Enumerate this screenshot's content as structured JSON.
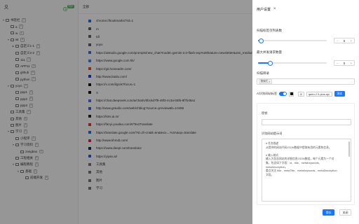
{
  "toolbar": {
    "sync_badge": "同步"
  },
  "tree": [
    {
      "label": "书签栏",
      "count": "2",
      "depth": 0,
      "caret": "▼"
    },
    {
      "label": "a",
      "count": "0",
      "depth": 1,
      "caret": ""
    },
    {
      "label": "w",
      "count": "1",
      "depth": 1,
      "caret": ""
    },
    {
      "label": "wt",
      "count": "4",
      "depth": 1,
      "caret": "▼"
    },
    {
      "label": "自定义1-1",
      "count": "1",
      "depth": 2,
      "caret": "▶"
    },
    {
      "label": "自定义2-2",
      "count": "0",
      "depth": 2,
      "caret": ""
    },
    {
      "label": "111",
      "count": "1",
      "depth": 2,
      "caret": ""
    },
    {
      "label": "APP11",
      "count": "1",
      "depth": 2,
      "caret": ""
    },
    {
      "label": "github",
      "count": "3",
      "depth": 2,
      "caret": ""
    },
    {
      "label": "python",
      "count": "1",
      "depth": 2,
      "caret": ""
    },
    {
      "label": "yoyo",
      "count": "3",
      "depth": 1,
      "caret": "▼"
    },
    {
      "label": "ppp1",
      "count": "1",
      "depth": 2,
      "caret": ""
    },
    {
      "label": "ppp2",
      "count": "0",
      "depth": 2,
      "caret": ""
    },
    {
      "label": "ppp3",
      "count": "1",
      "depth": 2,
      "caret": ""
    },
    {
      "label": "工具集",
      "count": "2",
      "depth": 1,
      "caret": ""
    },
    {
      "label": "其他",
      "count": "3",
      "depth": 1,
      "caret": ""
    },
    {
      "label": "图片",
      "count": "1",
      "depth": 1,
      "caret": ""
    },
    {
      "label": "学习",
      "count": "3",
      "depth": 1,
      "caret": "▼"
    },
    {
      "label": "小程序",
      "count": "1",
      "depth": 2,
      "caret": ""
    },
    {
      "label": "学习资料",
      "count": "2",
      "depth": 2,
      "caret": "▼"
    },
    {
      "label": "zangbao",
      "count": "0",
      "depth": 3,
      "caret": ""
    },
    {
      "label": "工程相关",
      "count": "0",
      "depth": 2,
      "caret": ""
    },
    {
      "label": "编程教程",
      "count": "1",
      "depth": 2,
      "caret": "▼"
    },
    {
      "label": "基础",
      "count": "2",
      "depth": 3,
      "caret": "▼"
    },
    {
      "label": "前端开发",
      "count": "3",
      "depth": 4,
      "caret": ""
    }
  ],
  "list_header": "全部",
  "list": [
    {
      "text": "chrome://bookmarks/?id=1",
      "color": "#1a73e8"
    },
    {
      "text": "m",
      "color": "#5f6368"
    },
    {
      "text": "tdl",
      "color": "#5f6368"
    },
    {
      "text": "yoyo",
      "color": "#5f6368"
    },
    {
      "text": "https://aistudio.google.com/prompts/new_chat?model=gemini-2.0-flash-exp%26feature=newsletter&utm_medium=email",
      "color": "#3a6fd8"
    },
    {
      "text": "https://www.google.com.hk/",
      "color": "#4285f4"
    },
    {
      "text": "https://git.homeadm.com/",
      "color": "#e44c30"
    },
    {
      "text": "http://www.baidu.com/",
      "color": "#2932e1"
    },
    {
      "text": "https://x.com/i/grok?focus=1",
      "color": "#111111"
    },
    {
      "text": "X",
      "color": "#111111"
    },
    {
      "text": "https://chat.deepseek.com/a/chat/s/0bc6d7f9-49f3-4c3a-b5f6-9f7b48a1",
      "color": "#4d6bfe"
    },
    {
      "text": "http://www.gstudio.com/web/chblog?source=preview&b=10486",
      "color": "#3366cc"
    },
    {
      "text": "https://kimi.ai.m/",
      "color": "#222222"
    },
    {
      "text": "https://fanyi.youdao.com/#/TextTranslate",
      "color": "#e0322a"
    },
    {
      "text": "https://translate.google.com/?sl=zh-cn&tl=en&text=...%3A&op=translate",
      "color": "#1a73e8"
    },
    {
      "text": "http://www.khmdt.com/",
      "color": "#e91e63"
    },
    {
      "text": "https://www.deepl.com/translator",
      "color": "#0f2b46"
    },
    {
      "text": "https://yiyan.ai/",
      "color": "#2b5ce6"
    },
    {
      "text": "工具集",
      "color": "#777777"
    },
    {
      "text": "其他",
      "color": "#777777"
    },
    {
      "text": "图片",
      "color": "#777777"
    },
    {
      "text": "学习",
      "color": "#777777"
    }
  ],
  "drawer": {
    "title": "用户设置",
    "label_1": "扫描标签页列表数",
    "value_1": "5",
    "level_1": 0.05,
    "label_2": "最大并发请求数量",
    "value_2": "5",
    "level_2": 0.18,
    "label_3": "扫描目录",
    "tag": "搜索栏",
    "meta_label": "AI识别网站标签",
    "model_select": "AI",
    "model_input": "qwen-2.5-plus-api",
    "test_button": "测试",
    "key_label": "密钥",
    "prompt_label": "识别网站提示词",
    "prompt_lines": [
      "# 任务描述",
      "从提供的网站代码JSON数据中提取有用的元素和信息。",
      "",
      "# 输入格式",
      "输入为包含网站的详细信息JSON数组，每个元素为一个对",
      "象，包含如下字段：id、title、metaKeywords、",
      "metaDescription。",
      "重点关注 title、metaTitle、metaKeywords、metaDescription",
      "字段。"
    ],
    "save_button": "保存",
    "close_button": "关闭"
  },
  "colors": {
    "accent": "#1677ff",
    "badge": "#59b35f"
  }
}
